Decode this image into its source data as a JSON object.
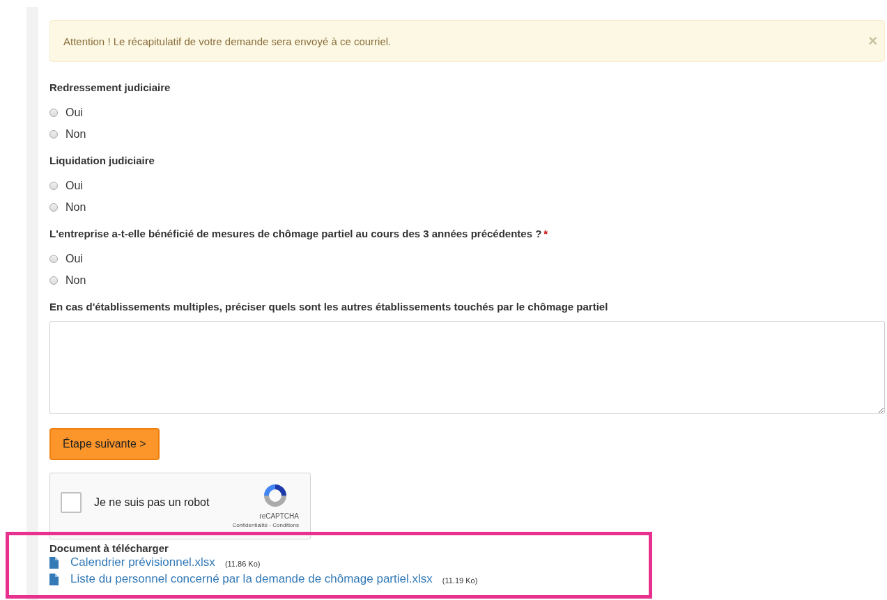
{
  "alert": {
    "text": "Attention ! Le récapitulatif de votre demande sera envoyé à ce courriel.",
    "close": "×"
  },
  "questions": [
    {
      "label": "Redressement judiciaire",
      "options": [
        {
          "label": "Oui",
          "selected": false
        },
        {
          "label": "Non",
          "selected": false
        }
      ]
    },
    {
      "label": "Liquidation judiciaire",
      "options": [
        {
          "label": "Oui",
          "selected": false
        },
        {
          "label": "Non",
          "selected": false
        }
      ]
    },
    {
      "label": "L'entreprise a-t-elle bénéficié de mesures de chômage partiel au cours des 3 années précédentes ?",
      "required_mark": "*",
      "options": [
        {
          "label": "Oui",
          "selected": false
        },
        {
          "label": "Non",
          "selected": false
        }
      ]
    }
  ],
  "textarea": {
    "label": "En cas d'établissements multiples, préciser quels sont les autres établissements touchés par le chômage partiel"
  },
  "next_button": "Étape suivante >",
  "captcha": {
    "label": "Je ne suis pas un robot",
    "checked": false,
    "brand": "reCAPTCHA",
    "links": "Confidentialité - Conditions"
  },
  "documents": {
    "title": "Document à télécharger",
    "files": [
      {
        "name": "Calendrier prévisionnel.xlsx",
        "size": "(11.86 Ko)"
      },
      {
        "name": "Liste du personnel concerné par la demande de chômage partiel.xlsx",
        "size": "(11.19 Ko)"
      }
    ]
  }
}
